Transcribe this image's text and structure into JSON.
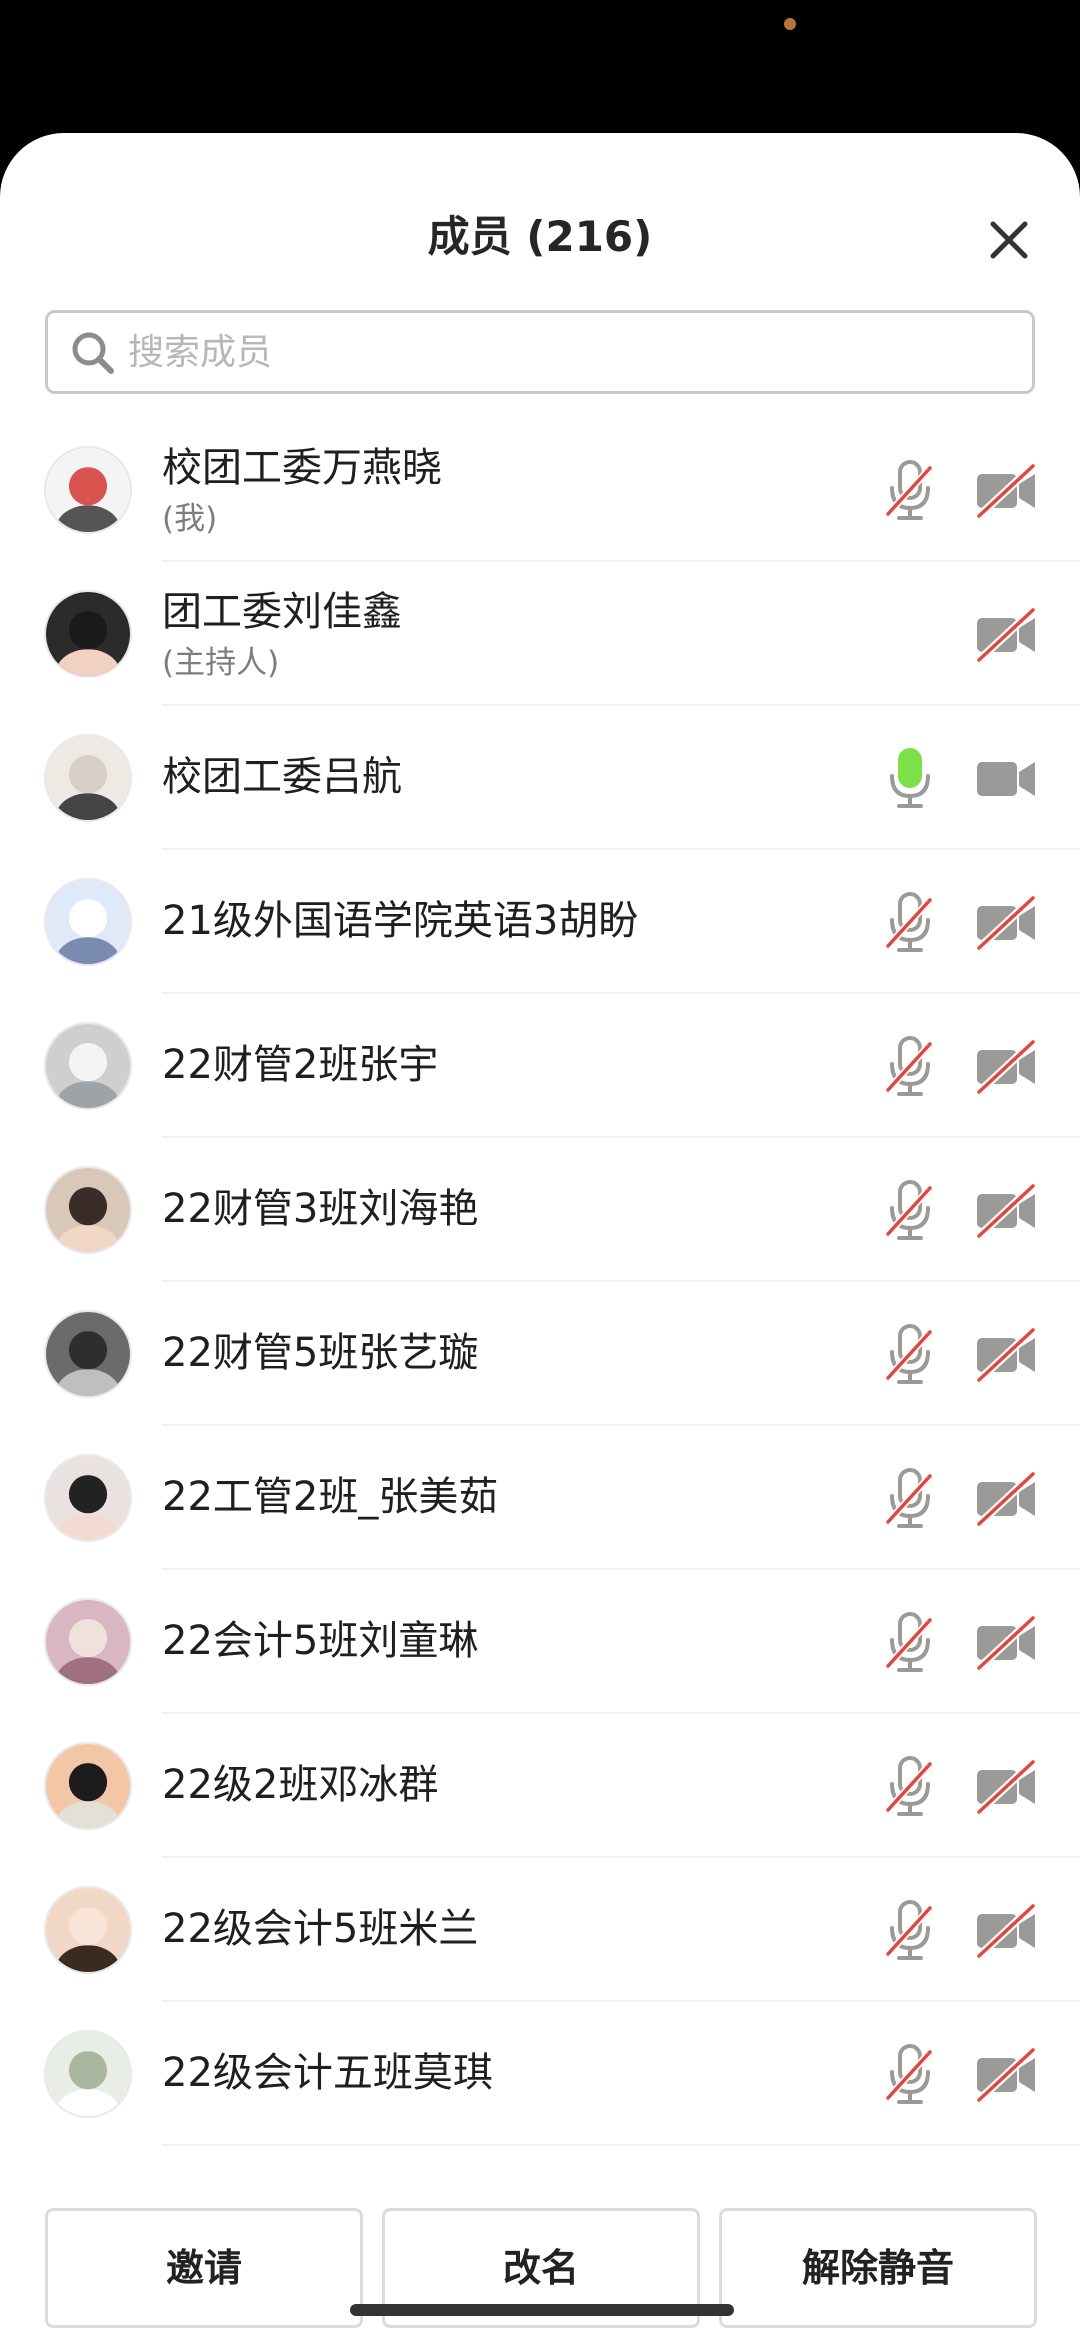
{
  "header": {
    "title": "成员 (216)",
    "close_icon": "close-icon"
  },
  "search": {
    "placeholder": "搜索成员",
    "value": "",
    "icon": "search-icon"
  },
  "members": [
    {
      "name": "校团工委万燕晓",
      "subtitle": "(我)",
      "mic": "muted",
      "camera": "off"
    },
    {
      "name": "团工委刘佳鑫",
      "subtitle": "(主持人)",
      "mic": "none",
      "camera": "off"
    },
    {
      "name": "校团工委吕航",
      "subtitle": "",
      "mic": "active",
      "camera": "on"
    },
    {
      "name": "21级外国语学院英语3胡盼",
      "subtitle": "",
      "mic": "muted",
      "camera": "off"
    },
    {
      "name": "22财管2班张宇",
      "subtitle": "",
      "mic": "muted",
      "camera": "off"
    },
    {
      "name": "22财管3班刘海艳",
      "subtitle": "",
      "mic": "muted",
      "camera": "off"
    },
    {
      "name": "22财管5班张艺璇",
      "subtitle": "",
      "mic": "muted",
      "camera": "off"
    },
    {
      "name": "22工管2班_张美茹",
      "subtitle": "",
      "mic": "muted",
      "camera": "off"
    },
    {
      "name": "22会计5班刘童琳",
      "subtitle": "",
      "mic": "muted",
      "camera": "off"
    },
    {
      "name": "22级2班邓冰群",
      "subtitle": "",
      "mic": "muted",
      "camera": "off"
    },
    {
      "name": "22级会计5班米兰",
      "subtitle": "",
      "mic": "muted",
      "camera": "off"
    },
    {
      "name": "22级会计五班莫琪",
      "subtitle": "",
      "mic": "muted",
      "camera": "off"
    }
  ],
  "footer": {
    "invite_label": "邀请",
    "rename_label": "改名",
    "unmute_label": "解除静音"
  },
  "colors": {
    "mic_active": "#7ee049",
    "muted_slash": "#e2473e",
    "icon_gray": "#9a9a9a"
  }
}
